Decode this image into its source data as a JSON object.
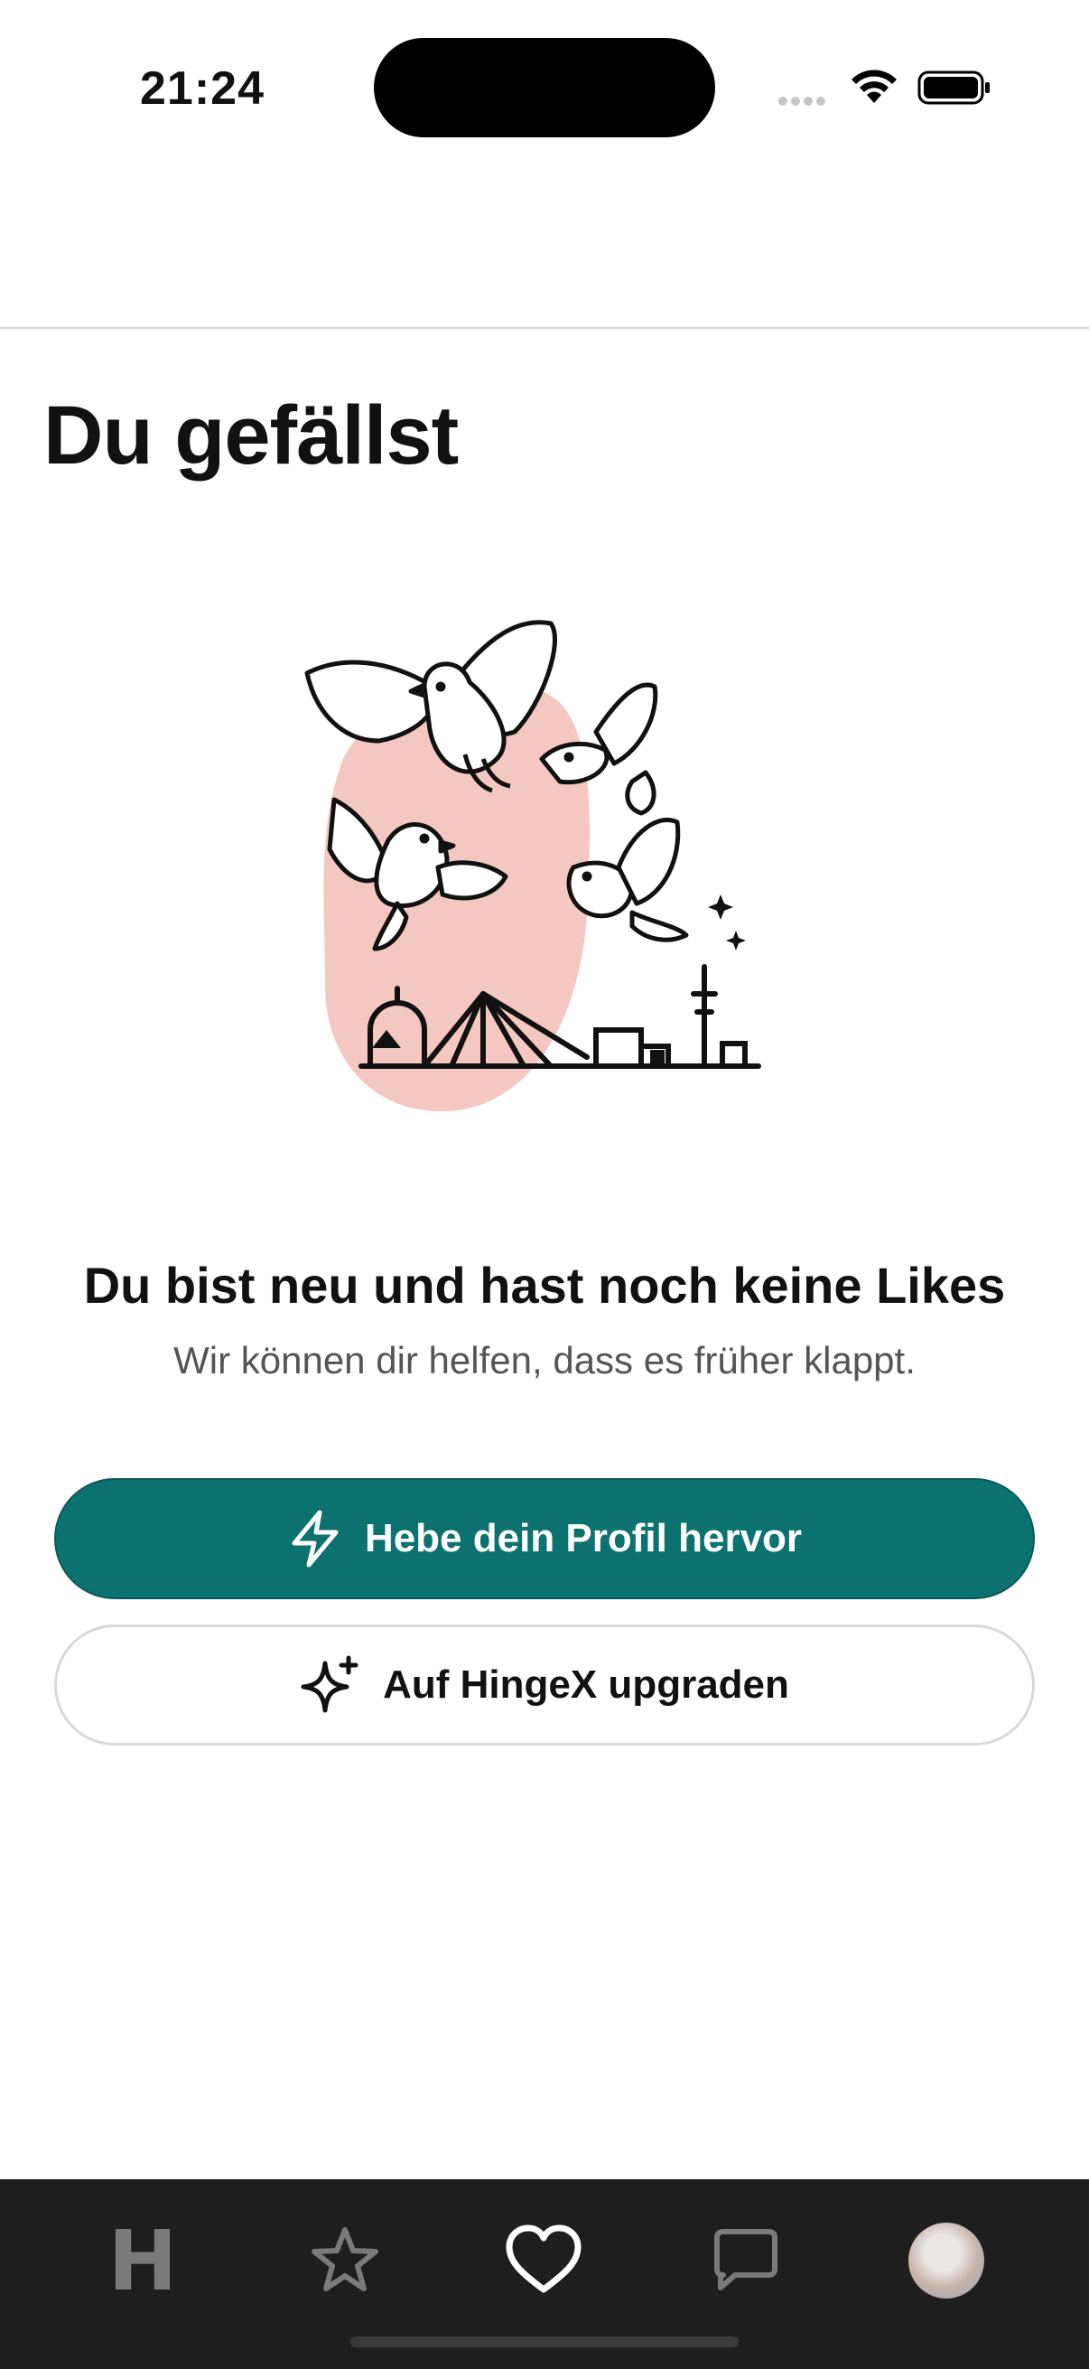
{
  "status_bar": {
    "time": "21:24"
  },
  "page": {
    "title": "Du gefällst"
  },
  "empty_state": {
    "title": "Du bist neu und hast noch keine Likes",
    "subtitle": "Wir können dir helfen, dass es früher klappt."
  },
  "buttons": {
    "boost_label": "Hebe dein Profil hervor",
    "boost_icon": "lightning-icon",
    "upgrade_label": "Auf HingeX upgraden",
    "upgrade_icon": "sparkle-icon"
  },
  "tab_bar": {
    "logo_glyph": "H",
    "items": [
      {
        "name": "home",
        "icon": "hinge-logo-icon",
        "active": false
      },
      {
        "name": "standouts",
        "icon": "star-icon",
        "active": false
      },
      {
        "name": "likes",
        "icon": "heart-icon",
        "active": true
      },
      {
        "name": "matches",
        "icon": "chat-icon",
        "active": false
      },
      {
        "name": "profile",
        "icon": "avatar",
        "active": false
      }
    ]
  },
  "colors": {
    "primary_button": "#0c7270",
    "tab_bar_bg": "#1e1e1e",
    "illustration_blob": "#f4c8c1"
  }
}
